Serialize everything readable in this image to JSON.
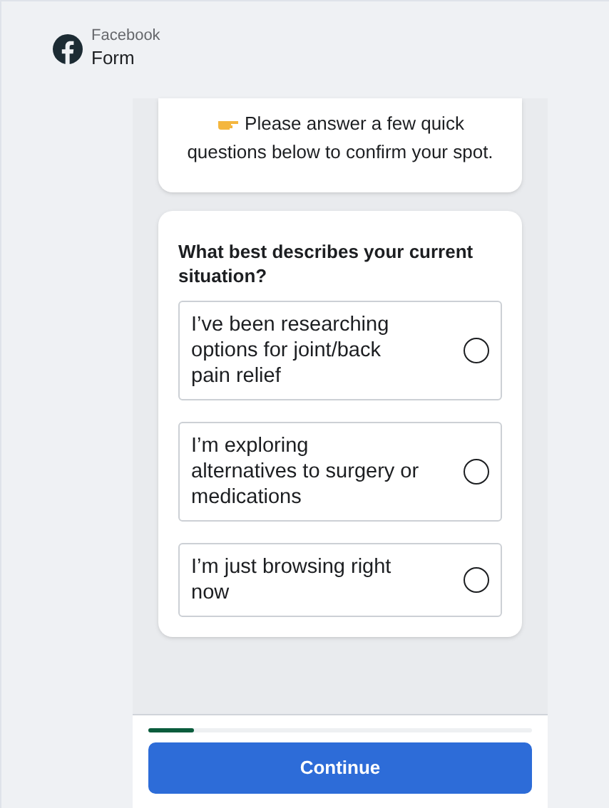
{
  "header": {
    "brand": "Facebook",
    "title": "Form"
  },
  "intro": {
    "text": "Please answer a few quick questions below to confirm your spot."
  },
  "question": {
    "text": "What best describes your current situation?",
    "options": [
      {
        "label": "I’ve been researching options for joint/back pain relief",
        "selected": false
      },
      {
        "label": "I’m exploring alternatives to surgery or medications",
        "selected": false
      },
      {
        "label": "I’m just browsing right now",
        "selected": false
      }
    ]
  },
  "progress": {
    "level": 0.12
  },
  "button": {
    "label": "Continue"
  }
}
